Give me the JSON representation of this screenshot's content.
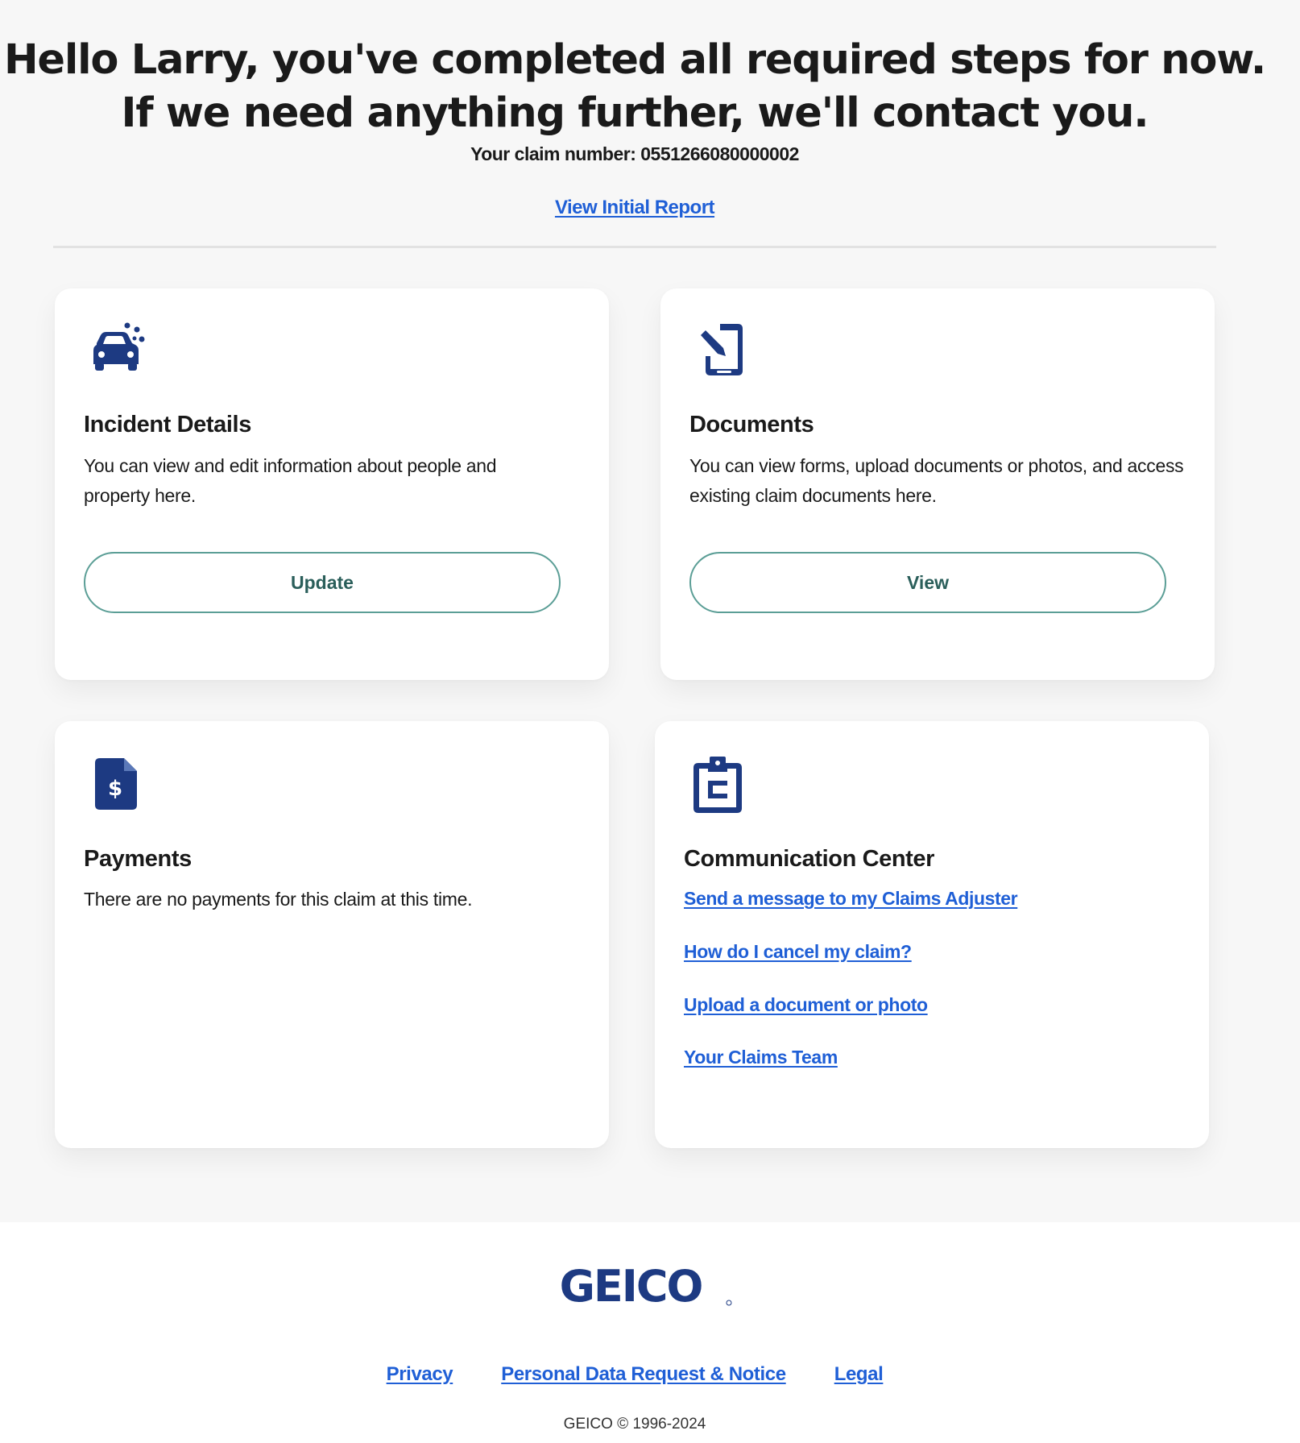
{
  "header": {
    "headline_line1": "Hello Larry, you've completed all required steps for now.",
    "headline_line2": "If we need anything further, we'll contact you.",
    "claim_number": "Your claim number: 0551266080000002",
    "view_report_link": "View Initial Report"
  },
  "cards": {
    "incident": {
      "icon": "car-accident-icon",
      "title": "Incident Details",
      "description": "You can view and edit information about people and property here.",
      "button": "Update"
    },
    "documents": {
      "icon": "mobile-upload-icon",
      "title": "Documents",
      "description": "You can view forms, upload documents or photos, and access existing claim documents here.",
      "button": "View"
    },
    "payments": {
      "icon": "dollar-document-icon",
      "title": "Payments",
      "description": "There are no payments for this claim at this time."
    },
    "communication": {
      "icon": "clipboard-icon",
      "title": "Communication Center",
      "links": [
        "Send a message to my Claims Adjuster",
        "How do I cancel my claim?",
        "Upload a document or photo",
        "Your Claims Team"
      ]
    }
  },
  "footer": {
    "logo_text": "GEICO",
    "links": [
      "Privacy",
      "Personal Data Request & Notice",
      "Legal"
    ],
    "copyright": "GEICO © 1996-2024"
  },
  "colors": {
    "page_background": "#f7f7f7",
    "link": "#1f5fd6",
    "icon_navy": "#1d3a82",
    "button_border": "#5b9e96",
    "button_text": "#2a5e5a",
    "logo": "#1d3a82"
  }
}
